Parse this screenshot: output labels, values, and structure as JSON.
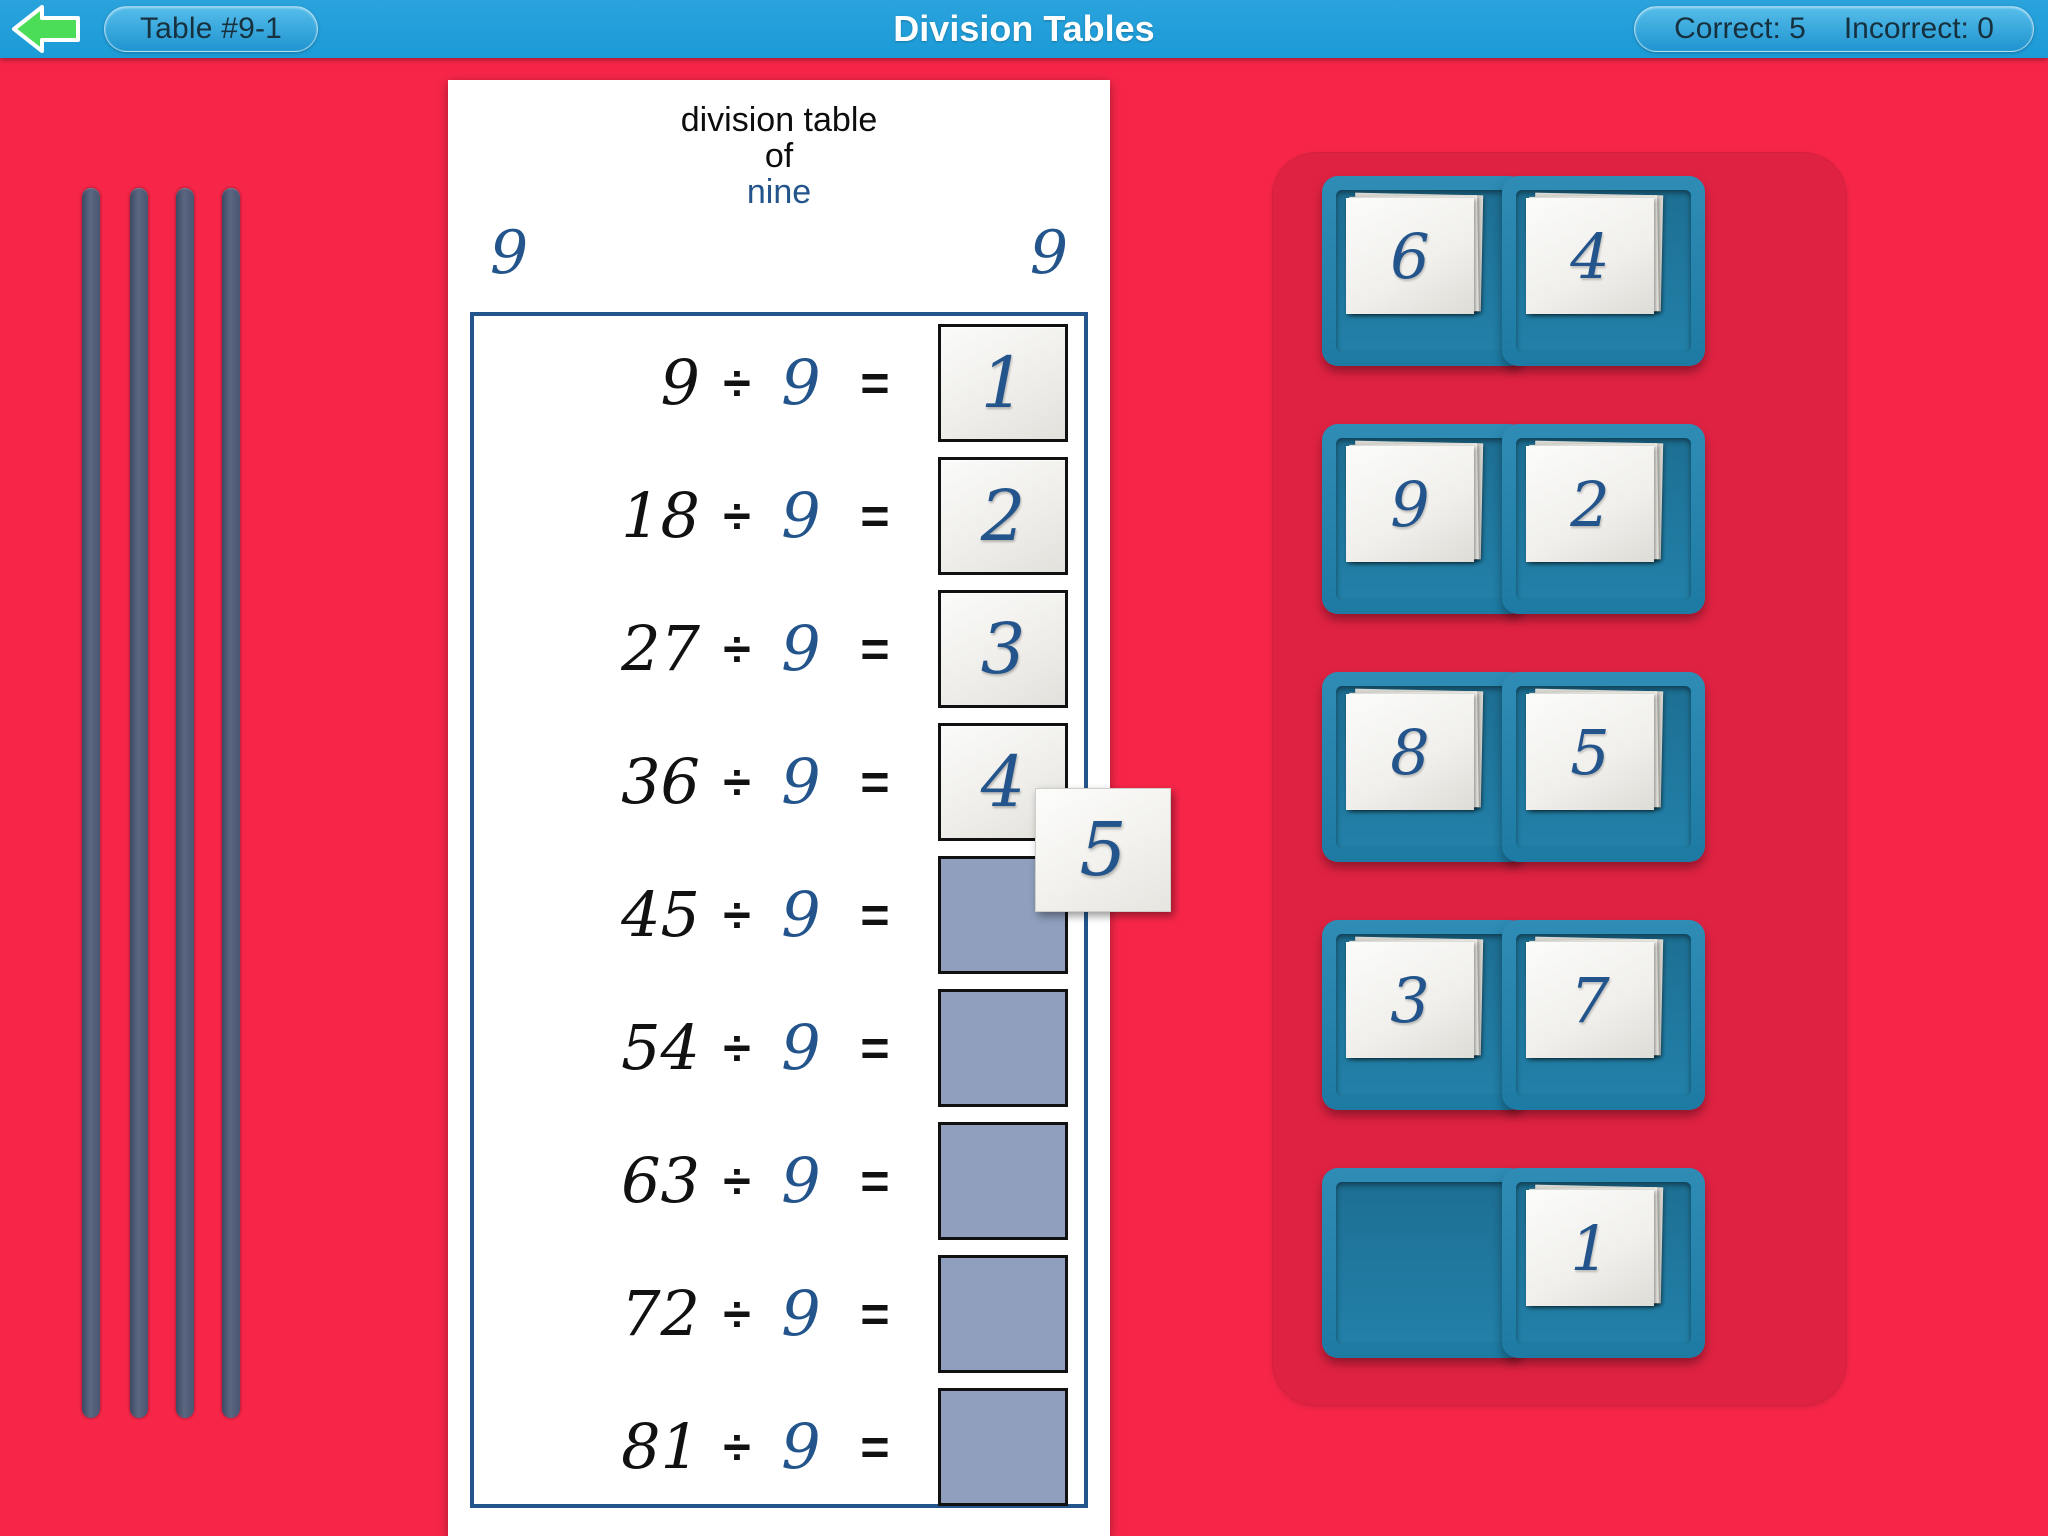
{
  "topbar": {
    "back_icon": "back-arrow-icon",
    "table_label": "Table #9-1",
    "title": "Division Tables",
    "correct_label": "Correct: 5",
    "incorrect_label": "Incorrect: 0",
    "bar_color": "#1b9bd7",
    "back_arrow_color": "#4BDD58"
  },
  "background": {
    "color": "#F72649",
    "tray_color": "#E02242"
  },
  "left_bars": {
    "count": 4,
    "color": "#4a5672"
  },
  "card": {
    "heading_line1": "division table",
    "heading_line2": "of",
    "heading_line3": "nine",
    "corner_left": "9",
    "corner_right": "9",
    "border_color": "#23558c"
  },
  "rows": [
    {
      "dividend": "9",
      "divsign": "÷",
      "divisor": "9",
      "eqsign": "=",
      "answer": "1",
      "filled": true
    },
    {
      "dividend": "18",
      "divsign": "÷",
      "divisor": "9",
      "eqsign": "=",
      "answer": "2",
      "filled": true
    },
    {
      "dividend": "27",
      "divsign": "÷",
      "divisor": "9",
      "eqsign": "=",
      "answer": "3",
      "filled": true
    },
    {
      "dividend": "36",
      "divsign": "÷",
      "divisor": "9",
      "eqsign": "=",
      "answer": "4",
      "filled": true
    },
    {
      "dividend": "45",
      "divsign": "÷",
      "divisor": "9",
      "eqsign": "=",
      "answer": "",
      "filled": false
    },
    {
      "dividend": "54",
      "divsign": "÷",
      "divisor": "9",
      "eqsign": "=",
      "answer": "",
      "filled": false
    },
    {
      "dividend": "63",
      "divsign": "÷",
      "divisor": "9",
      "eqsign": "=",
      "answer": "",
      "filled": false
    },
    {
      "dividend": "72",
      "divsign": "÷",
      "divisor": "9",
      "eqsign": "=",
      "answer": "",
      "filled": false
    },
    {
      "dividend": "81",
      "divsign": "÷",
      "divisor": "9",
      "eqsign": "=",
      "answer": "",
      "filled": false
    }
  ],
  "drag_card": {
    "value": "5"
  },
  "tray": {
    "tiles": [
      {
        "value": "6",
        "empty": false
      },
      {
        "value": "4",
        "empty": false
      },
      {
        "value": "9",
        "empty": false
      },
      {
        "value": "2",
        "empty": false
      },
      {
        "value": "8",
        "empty": false
      },
      {
        "value": "5",
        "empty": false
      },
      {
        "value": "3",
        "empty": false
      },
      {
        "value": "7",
        "empty": false
      },
      {
        "value": "",
        "empty": true
      },
      {
        "value": "1",
        "empty": false
      }
    ]
  }
}
